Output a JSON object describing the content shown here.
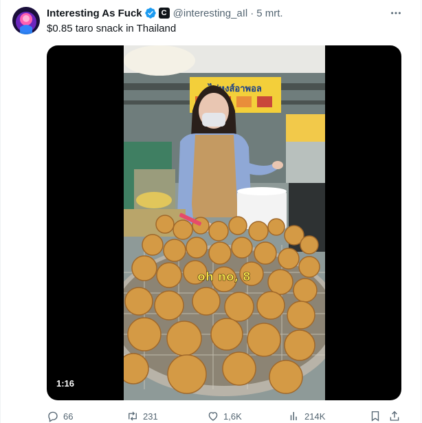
{
  "tweet": {
    "author_name": "Interesting As Fuck",
    "verified_icon": "verified-badge-icon",
    "affiliate_badge": "C",
    "handle": "@interesting_aIl",
    "separator": "·",
    "timestamp": "5 mrt.",
    "text": "$0.85 taro snack in Thailand"
  },
  "media": {
    "type": "video",
    "duration": "1:16",
    "caption_overlay": "oh no, 8",
    "shop_sign": "ไข่หงส์อาพอล"
  },
  "actions": {
    "replies": "66",
    "reposts": "231",
    "likes": "1,6K",
    "views": "214K"
  },
  "colors": {
    "text": "#0f1419",
    "secondary_text": "#536471",
    "verified_blue": "#1d9bf0",
    "border": "#eff3f4"
  }
}
